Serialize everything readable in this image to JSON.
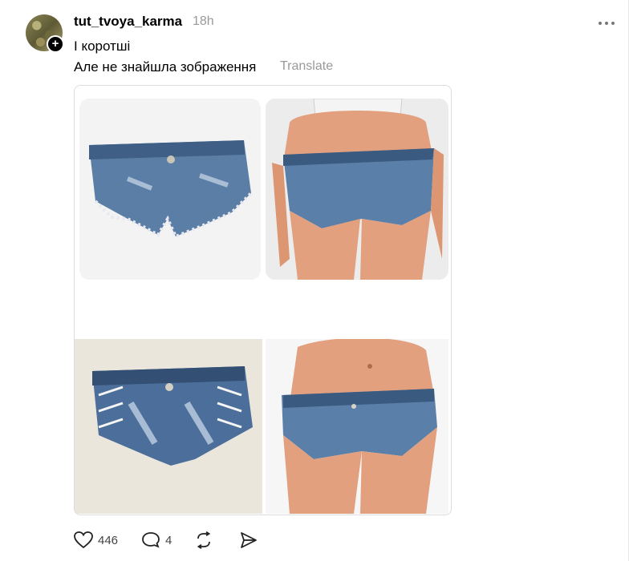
{
  "post": {
    "username": "tut_tvoya_karma",
    "timestamp": "18h",
    "more_icon": "more-horizontal-icon",
    "text_line1": "І коротші",
    "text_line2": "Але не знайшла зображення",
    "translate_label": "Translate"
  },
  "images": [
    {
      "subject": "denim-shorts-product"
    },
    {
      "subject": "denim-shorts-back-view"
    },
    {
      "subject": "lace-up-denim-shorts-product"
    },
    {
      "subject": "denim-shorts-front-view"
    }
  ],
  "actions": {
    "like_icon": "heart-icon",
    "like_count": "446",
    "reply_icon": "comment-icon",
    "reply_count": "4",
    "repost_icon": "repost-icon",
    "share_icon": "share-icon"
  },
  "colors": {
    "denim": "#5a7fa8",
    "denim_dark": "#3b5a80",
    "skin": "#e2a07e",
    "muted_text": "#999999"
  }
}
